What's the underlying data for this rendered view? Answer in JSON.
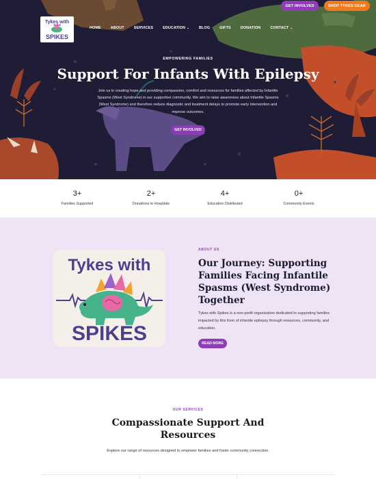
{
  "top_actions": {
    "get_involved": "GET INVOLVED",
    "shop": "SHOP TYKES GEAR"
  },
  "logo": {
    "line1": "Tykes with",
    "line2": "SPIKES"
  },
  "nav": {
    "items": [
      "HOME",
      "ABOUT",
      "SERVICES",
      "EDUCATION",
      "BLOG",
      "GIFTS",
      "DONATION",
      "CONTACT"
    ]
  },
  "hero": {
    "kicker": "EMPOWERING FAMILIES",
    "title": "Support For Infants With Epilepsy",
    "text": "Join us in creating hope and providing compassion, comfort and resources for families affected by Infantile Spasms (West Syndrome) in our supportive community. We aim to raise awareness about Infantile Spasms (West Syndrome) and therefore reduce diagnostic and treatment delays to promote early intervention and improve outcomes.",
    "button": "GET INVOLVED"
  },
  "stats": [
    {
      "value": "3+",
      "label": "Families Supported"
    },
    {
      "value": "2+",
      "label": "Donations to Hospitals"
    },
    {
      "value": "4+",
      "label": "Education Distributed"
    },
    {
      "value": "0+",
      "label": "Community Events"
    }
  ],
  "about": {
    "kicker": "ABOUT US",
    "title": "Our Journey: Supporting Families Facing Infantile Spasms (West Syndrome) Together",
    "text": "Tykes with Spikes is a non-profit organization dedicated to supporting families impacted by this form of infantile epilepsy through resources, community, and education.",
    "button": "READ MORE",
    "logo_line1": "Tykes with",
    "logo_line2": "SPIKES"
  },
  "services": {
    "kicker": "OUR SERVICES",
    "title": "Compassionate Support And Resources",
    "text": "Explore our range of resources designed to empower families and foster community connection."
  },
  "colors": {
    "purple": "#8e3db7",
    "orange": "#f07a1c",
    "hero_bg": "#1f1c36",
    "about_bg": "#efe4f5"
  }
}
